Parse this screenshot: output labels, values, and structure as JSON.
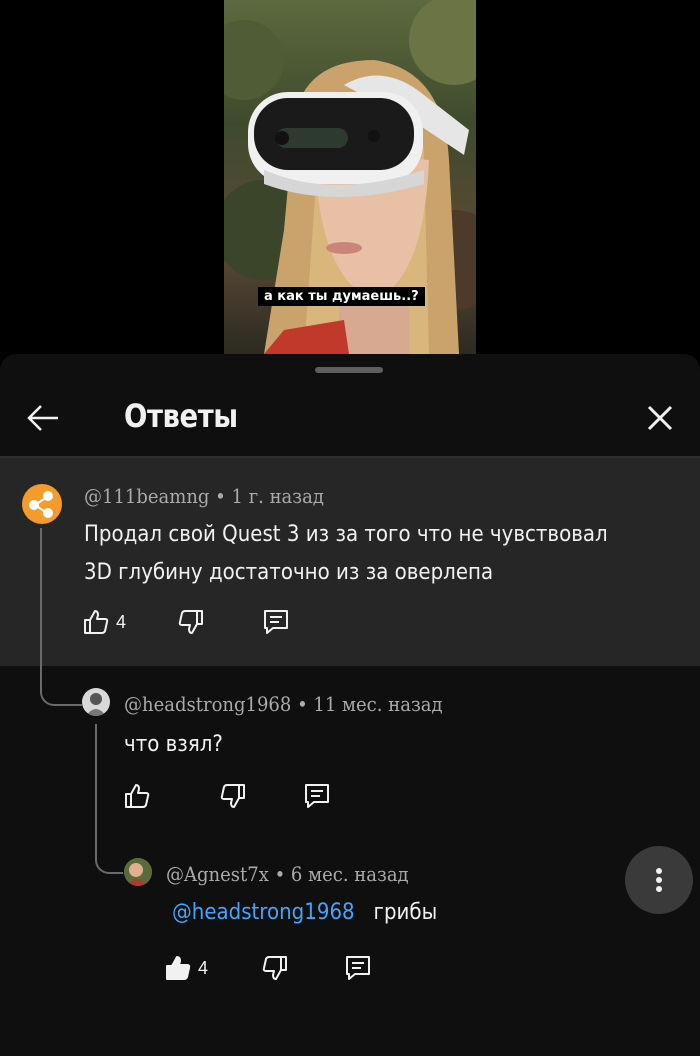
{
  "video": {
    "subtitle": "а как ты думаешь..?"
  },
  "panel": {
    "title": "Ответы"
  },
  "comments": [
    {
      "author": "@111beamng",
      "time": "1 г. назад",
      "text_lines": [
        "Продал свой Quest 3 из за того что не чувствовал",
        "3D глубину достаточно из за оверлепа"
      ],
      "likes": "4"
    },
    {
      "author": "@headstrong1968",
      "time": "11 мес. назад",
      "text_lines": [
        "что взял?"
      ],
      "likes": ""
    },
    {
      "author": "@Agnest7x",
      "time": "6 мес. назад",
      "mention": "@headstrong1968",
      "text": "грибы",
      "likes": "4"
    }
  ],
  "colors": {
    "mention": "#3ea6ff",
    "parent_bg": "#262626",
    "sheet_bg": "#0f0f0f",
    "avatar1": "#f39c2b"
  }
}
